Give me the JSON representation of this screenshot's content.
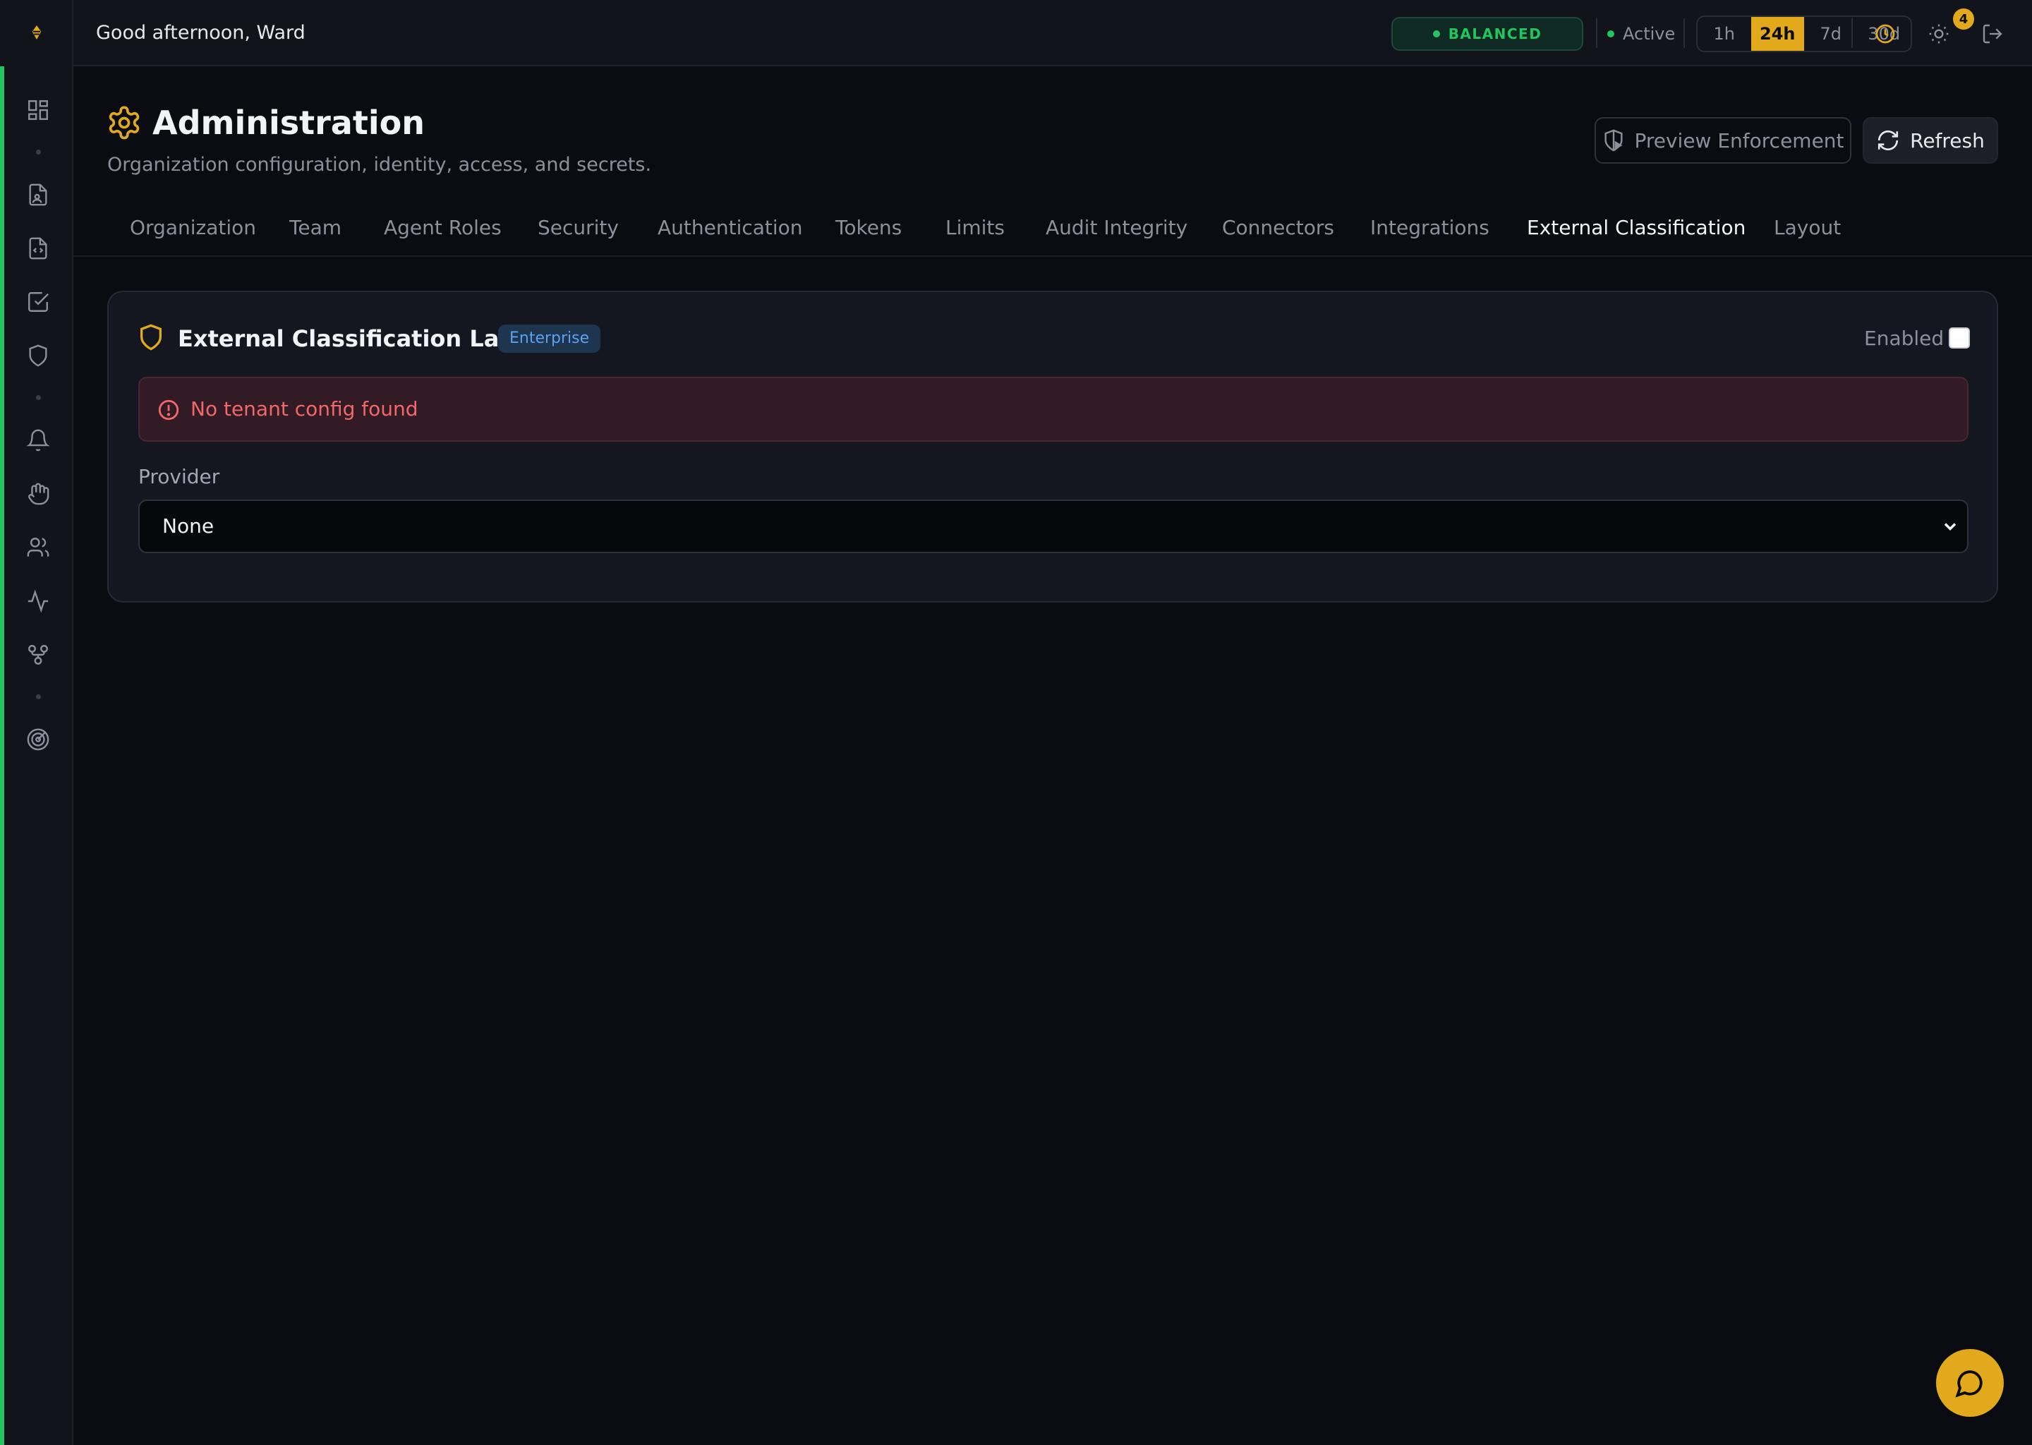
{
  "topbar": {
    "greeting": "Good afternoon, Ward",
    "mode": "BALANCED",
    "status": "Active",
    "ranges": [
      "1h",
      "24h",
      "7d",
      "30d"
    ],
    "active_range": "24h",
    "notification_count": "4"
  },
  "page": {
    "title": "Administration",
    "subtitle": "Organization configuration, identity, access, and secrets.",
    "preview_button": "Preview Enforcement",
    "refresh_button": "Refresh"
  },
  "tabs": [
    "Organization",
    "Team",
    "Agent Roles",
    "Security",
    "Authentication",
    "Tokens",
    "Limits",
    "Audit Integrity",
    "Connectors",
    "Integrations",
    "External Classification",
    "Layout"
  ],
  "active_tab": "External Classification",
  "card": {
    "title": "External Classification Labels",
    "badge": "Enterprise",
    "enabled_label": "Enabled",
    "enabled": false,
    "alert": "No tenant config found",
    "provider_label": "Provider",
    "provider_value": "None"
  },
  "icons": {
    "sidebar": [
      "dashboard-icon",
      "file-user-icon",
      "file-code-icon",
      "checkbox-icon",
      "shield-icon",
      "bell-icon",
      "hand-icon",
      "users-icon",
      "activity-icon",
      "git-fork-icon",
      "radar-icon"
    ],
    "topbar": [
      "clock-icon",
      "sun-icon",
      "logout-icon"
    ]
  },
  "colors": {
    "accent": "#e3a91c",
    "success": "#22c55e",
    "danger": "#f06868",
    "info": "#5aa2f0"
  }
}
